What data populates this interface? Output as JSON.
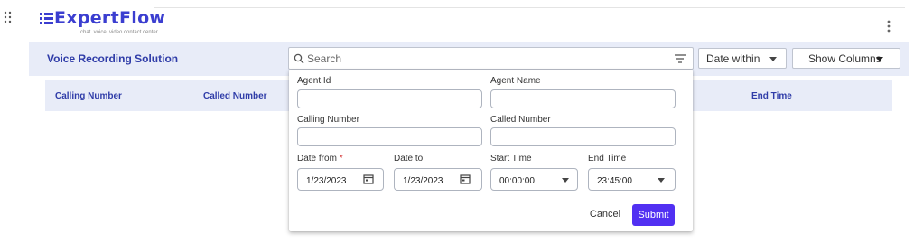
{
  "app": {
    "brand": "ExpertFlow",
    "tagline": "chat. voice. video contact center",
    "colors": {
      "brand": "#3b3ed0",
      "accent": "#5130f2",
      "header_bg": "#e8ecf8",
      "header_text": "#2f3ca8"
    }
  },
  "icons": {
    "grip": "grip-dots-icon",
    "menu": "kebab-menu-icon",
    "search": "search-icon",
    "filter": "filter-lines-icon",
    "calendar": "calendar-icon",
    "caret": "caret-down-icon"
  },
  "toolbar": {
    "title": "Voice Recording Solution",
    "search_placeholder": "Search",
    "date_select": "Date within",
    "show_columns": "Show Columns"
  },
  "table": {
    "columns": [
      "Calling Number",
      "Called Number",
      "End Time"
    ]
  },
  "filter_panel": {
    "agent_id_label": "Agent Id",
    "agent_id_value": "",
    "agent_name_label": "Agent Name",
    "agent_name_value": "",
    "calling_number_label": "Calling Number",
    "calling_number_value": "",
    "called_number_label": "Called Number",
    "called_number_value": "",
    "date_from_label": "Date from",
    "required_marker": "*",
    "date_from_value": "1/23/2023",
    "date_to_label": "Date to",
    "date_to_value": "1/23/2023",
    "start_time_label": "Start Time",
    "start_time_value": "00:00:00",
    "end_time_label": "End Time",
    "end_time_value": "23:45:00",
    "cancel_label": "Cancel",
    "submit_label": "Submit"
  }
}
